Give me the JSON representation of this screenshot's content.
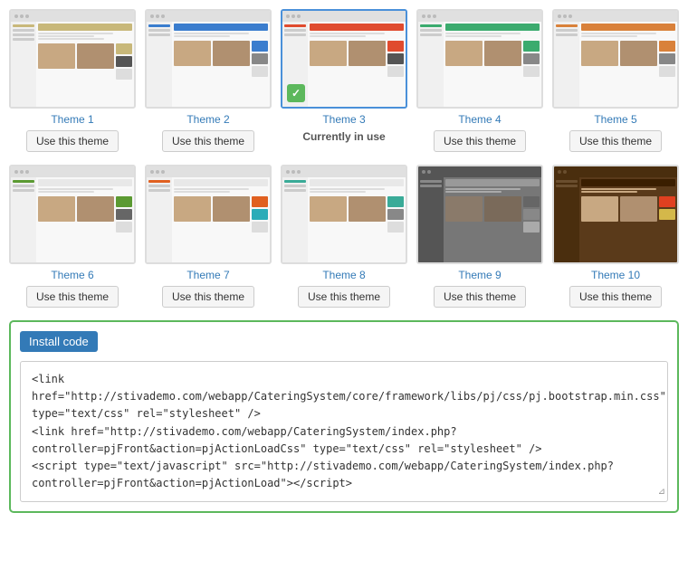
{
  "themes": {
    "row1": [
      {
        "id": "theme1",
        "name": "Theme 1",
        "button": "Use this theme",
        "active": false,
        "nameColor": "blue"
      },
      {
        "id": "theme2",
        "name": "Theme 2",
        "button": "Use this theme",
        "active": false,
        "nameColor": "blue"
      },
      {
        "id": "theme3",
        "name": "Theme 3",
        "button": "Currently in use",
        "active": true,
        "nameColor": "blue"
      },
      {
        "id": "theme4",
        "name": "Theme 4",
        "button": "Use this theme",
        "active": false,
        "nameColor": "blue"
      },
      {
        "id": "theme5",
        "name": "Theme 5",
        "button": "Use this theme",
        "active": false,
        "nameColor": "blue"
      }
    ],
    "row2": [
      {
        "id": "theme6",
        "name": "Theme 6",
        "button": "Use this theme",
        "active": false,
        "nameColor": "blue"
      },
      {
        "id": "theme7",
        "name": "Theme 7",
        "button": "Use this theme",
        "active": false,
        "nameColor": "blue"
      },
      {
        "id": "theme8",
        "name": "Theme 8",
        "button": "Use this theme",
        "active": false,
        "nameColor": "blue"
      },
      {
        "id": "theme9",
        "name": "Theme 9",
        "button": "Use this theme",
        "active": false,
        "nameColor": "blue"
      },
      {
        "id": "theme10",
        "name": "Theme 10",
        "button": "Use this theme",
        "active": false,
        "nameColor": "blue"
      }
    ]
  },
  "install_code": {
    "label": "Install code",
    "code": "<link href=\"http://stivademo.com/webapp/CateringSystem/core/framework/libs/pj/css/pj.bootstrap.min.css\" type=\"text/css\" rel=\"stylesheet\" />\n<link href=\"http://stivademo.com/webapp/CateringSystem/index.php?controller=pjFront&action=pjActionLoadCss\" type=\"text/css\" rel=\"stylesheet\" />\n<script type=\"text/javascript\" src=\"http://stivademo.com/webapp/CateringSystem/index.php?controller=pjFront&action=pjActionLoad\"><\\/script>"
  }
}
